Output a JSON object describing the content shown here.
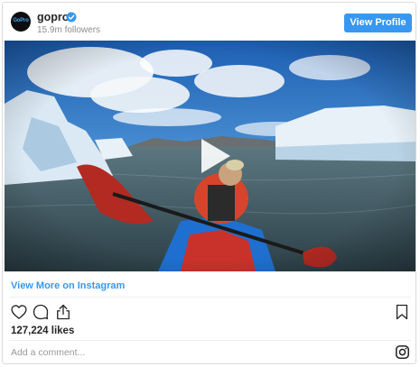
{
  "header": {
    "avatar_text": "GoPro",
    "username": "gopro",
    "followers": "15.9m followers",
    "view_profile_label": "View Profile"
  },
  "post": {
    "view_more_label": "View More on Instagram",
    "likes": "127,224 likes",
    "comment_placeholder": "Add a comment..."
  },
  "colors": {
    "accent": "#3897f0",
    "verified": "#3897f0",
    "text": "#262626",
    "muted": "#8e8e8e"
  },
  "icons": {
    "verified": "verified-badge-icon",
    "play": "play-icon",
    "like": "heart-icon",
    "comment": "comment-icon",
    "share": "share-icon",
    "save": "bookmark-icon",
    "instagram": "instagram-icon"
  }
}
